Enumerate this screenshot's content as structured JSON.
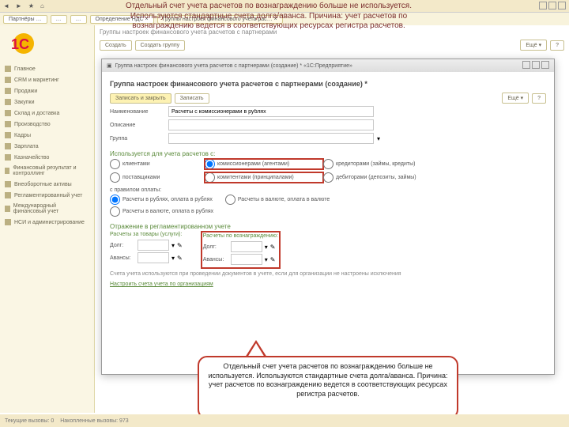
{
  "menubar": {
    "star": "★",
    "home": "⌂"
  },
  "tabs": [
    {
      "label": "Партнёры …"
    },
    {
      "label": "…"
    },
    {
      "label": "…"
    },
    {
      "label": "Определение НДС ×"
    },
    {
      "label": "Группы настроек финансового учета рас… ×"
    }
  ],
  "sidebar": [
    "Главное",
    "CRM и маркетинг",
    "Продажи",
    "Закупки",
    "Склад и доставка",
    "Производство",
    "Кадры",
    "Зарплата",
    "Казначейство",
    "Финансовый результат и контроллинг",
    "Внеоборотные активы",
    "Регламентированный учет",
    "Международный финансовый учет",
    "НСИ и администрирование"
  ],
  "breadcrumb": "Группы настроек финансового учета расчетов с партнерами",
  "toolbar": {
    "create": "Создать",
    "group": "Создать группу",
    "more": "Ещё ▾",
    "help": "?"
  },
  "modal": {
    "title": "Группа настроек финансового учета расчетов с партнерами (создание) *  «1С:Предприятие»",
    "heading": "Группа настроек финансового учета расчетов с партнерами (создание) *",
    "save_close": "Записать и закрыть",
    "save": "Записать",
    "field_name": "Наименование",
    "name_value": "Расчеты с комиссионерами в рублях",
    "field_desc": "Описание",
    "field_group": "Группа",
    "section_used": "Используется для учета расчетов с:",
    "used": {
      "clients": "клиентами",
      "commission": "комиссионерами (агентами)",
      "creditors": "кредиторами (займы, кредиты)",
      "suppliers": "поставщиками",
      "principals": "комитентами (принципалами)",
      "debtors": "дебиторами (депозиты, займы)"
    },
    "pay_rules_label": "с правилом оплаты:",
    "pay_rules": {
      "rr": "Расчеты в рублях, оплата в рублях",
      "vv": "Расчеты в валюте, оплата в валюте",
      "vr": "Расчеты в валюте, оплата в рублях"
    },
    "section_reg": "Отражение в регламентированном учете",
    "col_goods": "Расчеты за товары (услуги):",
    "col_fee": "Расчеты по вознаграждению:",
    "debt": "Долг:",
    "advance": "Авансы:",
    "hint": "Счета учета используются при проведении документов в учете, если для организации не настроены исключения",
    "link_org": "Настроить счета учета по организациям"
  },
  "annotation": "Отдельный счет учета расчетов по вознаграждению больше не используется. Используются стандартные счета долга/аванса. Причина: учет расчетов по вознаграждению ведется в соответствующих ресурсах регистра расчетов.",
  "status": {
    "calls": "Текущие вызовы: 0",
    "accum": "Накопленные вызовы: 973"
  }
}
